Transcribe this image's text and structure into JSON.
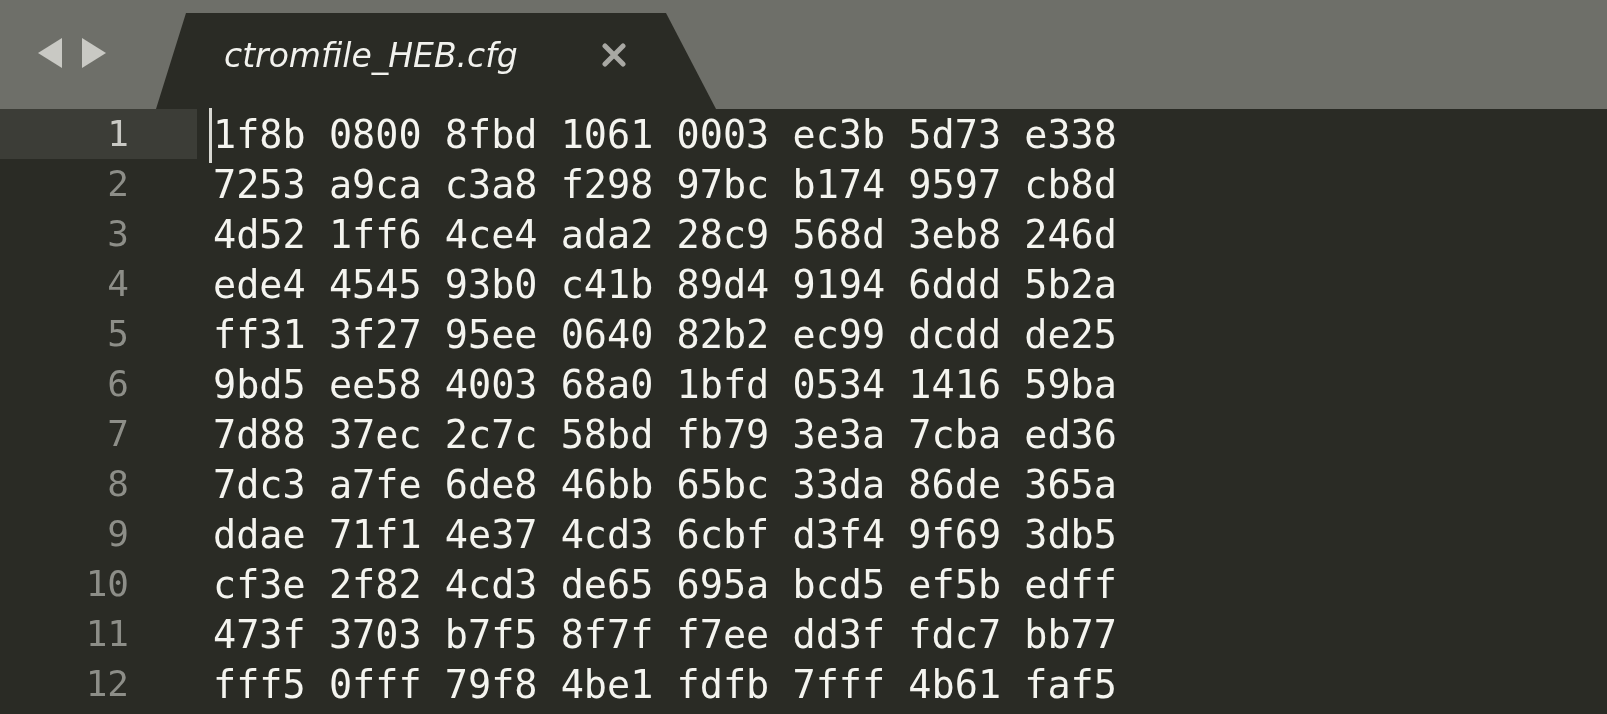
{
  "tab": {
    "title": "ctromfile_HEB.cfg",
    "selected": true
  },
  "lines": [
    {
      "number": "1",
      "text": "1f8b 0800 8fbd 1061 0003 ec3b 5d73 e338",
      "current": true
    },
    {
      "number": "2",
      "text": "7253 a9ca c3a8 f298 97bc b174 9597 cb8d",
      "current": false
    },
    {
      "number": "3",
      "text": "4d52 1ff6 4ce4 ada2 28c9 568d 3eb8 246d",
      "current": false
    },
    {
      "number": "4",
      "text": "ede4 4545 93b0 c41b 89d4 9194 6ddd 5b2a",
      "current": false
    },
    {
      "number": "5",
      "text": "ff31 3f27 95ee 0640 82b2 ec99 dcdd de25",
      "current": false
    },
    {
      "number": "6",
      "text": "9bd5 ee58 4003 68a0 1bfd 0534 1416 59ba",
      "current": false
    },
    {
      "number": "7",
      "text": "7d88 37ec 2c7c 58bd fb79 3e3a 7cba ed36",
      "current": false
    },
    {
      "number": "8",
      "text": "7dc3 a7fe 6de8 46bb 65bc 33da 86de 365a",
      "current": false
    },
    {
      "number": "9",
      "text": "ddae 71f1 4e37 4cd3 6cbf d3f4 9f69 3db5",
      "current": false
    },
    {
      "number": "10",
      "text": "cf3e 2f82 4cd3 de65 695a bcd5 ef5b edff",
      "current": false
    },
    {
      "number": "11",
      "text": "473f 3703 b7f5 8f7f f7ee dd3f fdc7 bb77",
      "current": false
    },
    {
      "number": "12",
      "text": "fff5 0fff 79f8 4be1 fdfb 7fff 4b61 faf5",
      "current": false
    }
  ]
}
